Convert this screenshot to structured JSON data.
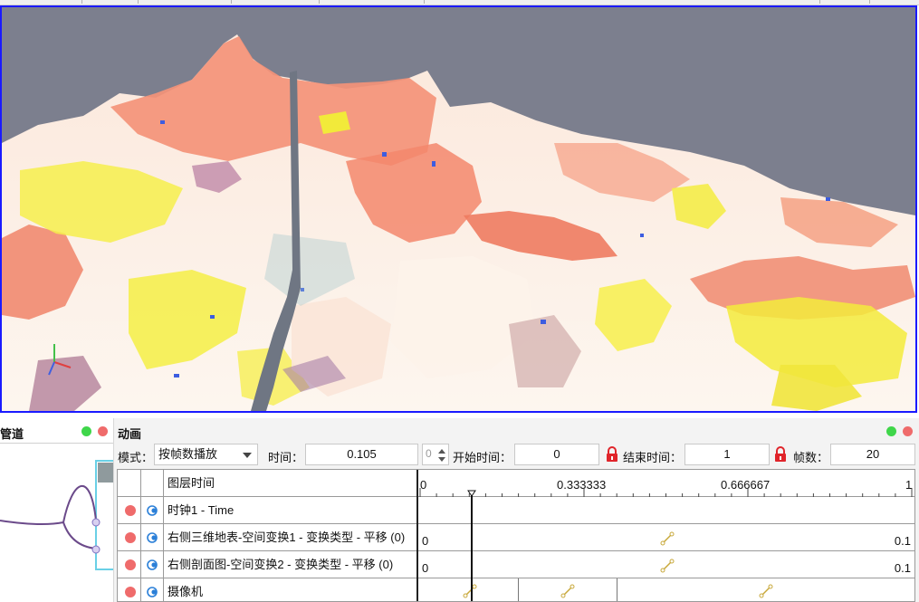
{
  "pipeline_panel": {
    "title": "管道"
  },
  "animation_panel": {
    "title": "动画",
    "mode_label": "模式：",
    "mode_value": "按帧数播放",
    "time_label": "时间：",
    "time_value": "0.105",
    "spin_value": "0",
    "start_label": "开始时间：",
    "start_value": "0",
    "end_label": "结束时间：",
    "end_value": "1",
    "frames_label": "帧数：",
    "frames_value": "20"
  },
  "timeline": {
    "header_label": "图层时间",
    "ticks": [
      "0",
      "0.333333",
      "0.666667",
      "1"
    ],
    "current_time": 0.105,
    "tracks": [
      {
        "label": "时钟1 - Time",
        "left_value": "",
        "right_value": ""
      },
      {
        "label": "右侧三维地表-空间变换1 - 变换类型 - 平移 (0)",
        "left_value": "0",
        "right_value": "0.1"
      },
      {
        "label": "右侧剖面图-空间变换2 - 变换类型 - 平移 (0)",
        "left_value": "0",
        "right_value": "0.1"
      },
      {
        "label": "摄像机",
        "left_value": "",
        "right_value": ""
      }
    ]
  },
  "colors": {
    "sky": "#7c7f8e",
    "viewport_border": "#1a1aff",
    "status_green": "#3fd64a",
    "status_red": "#ef6b6b",
    "lock_red": "#e0242a"
  }
}
